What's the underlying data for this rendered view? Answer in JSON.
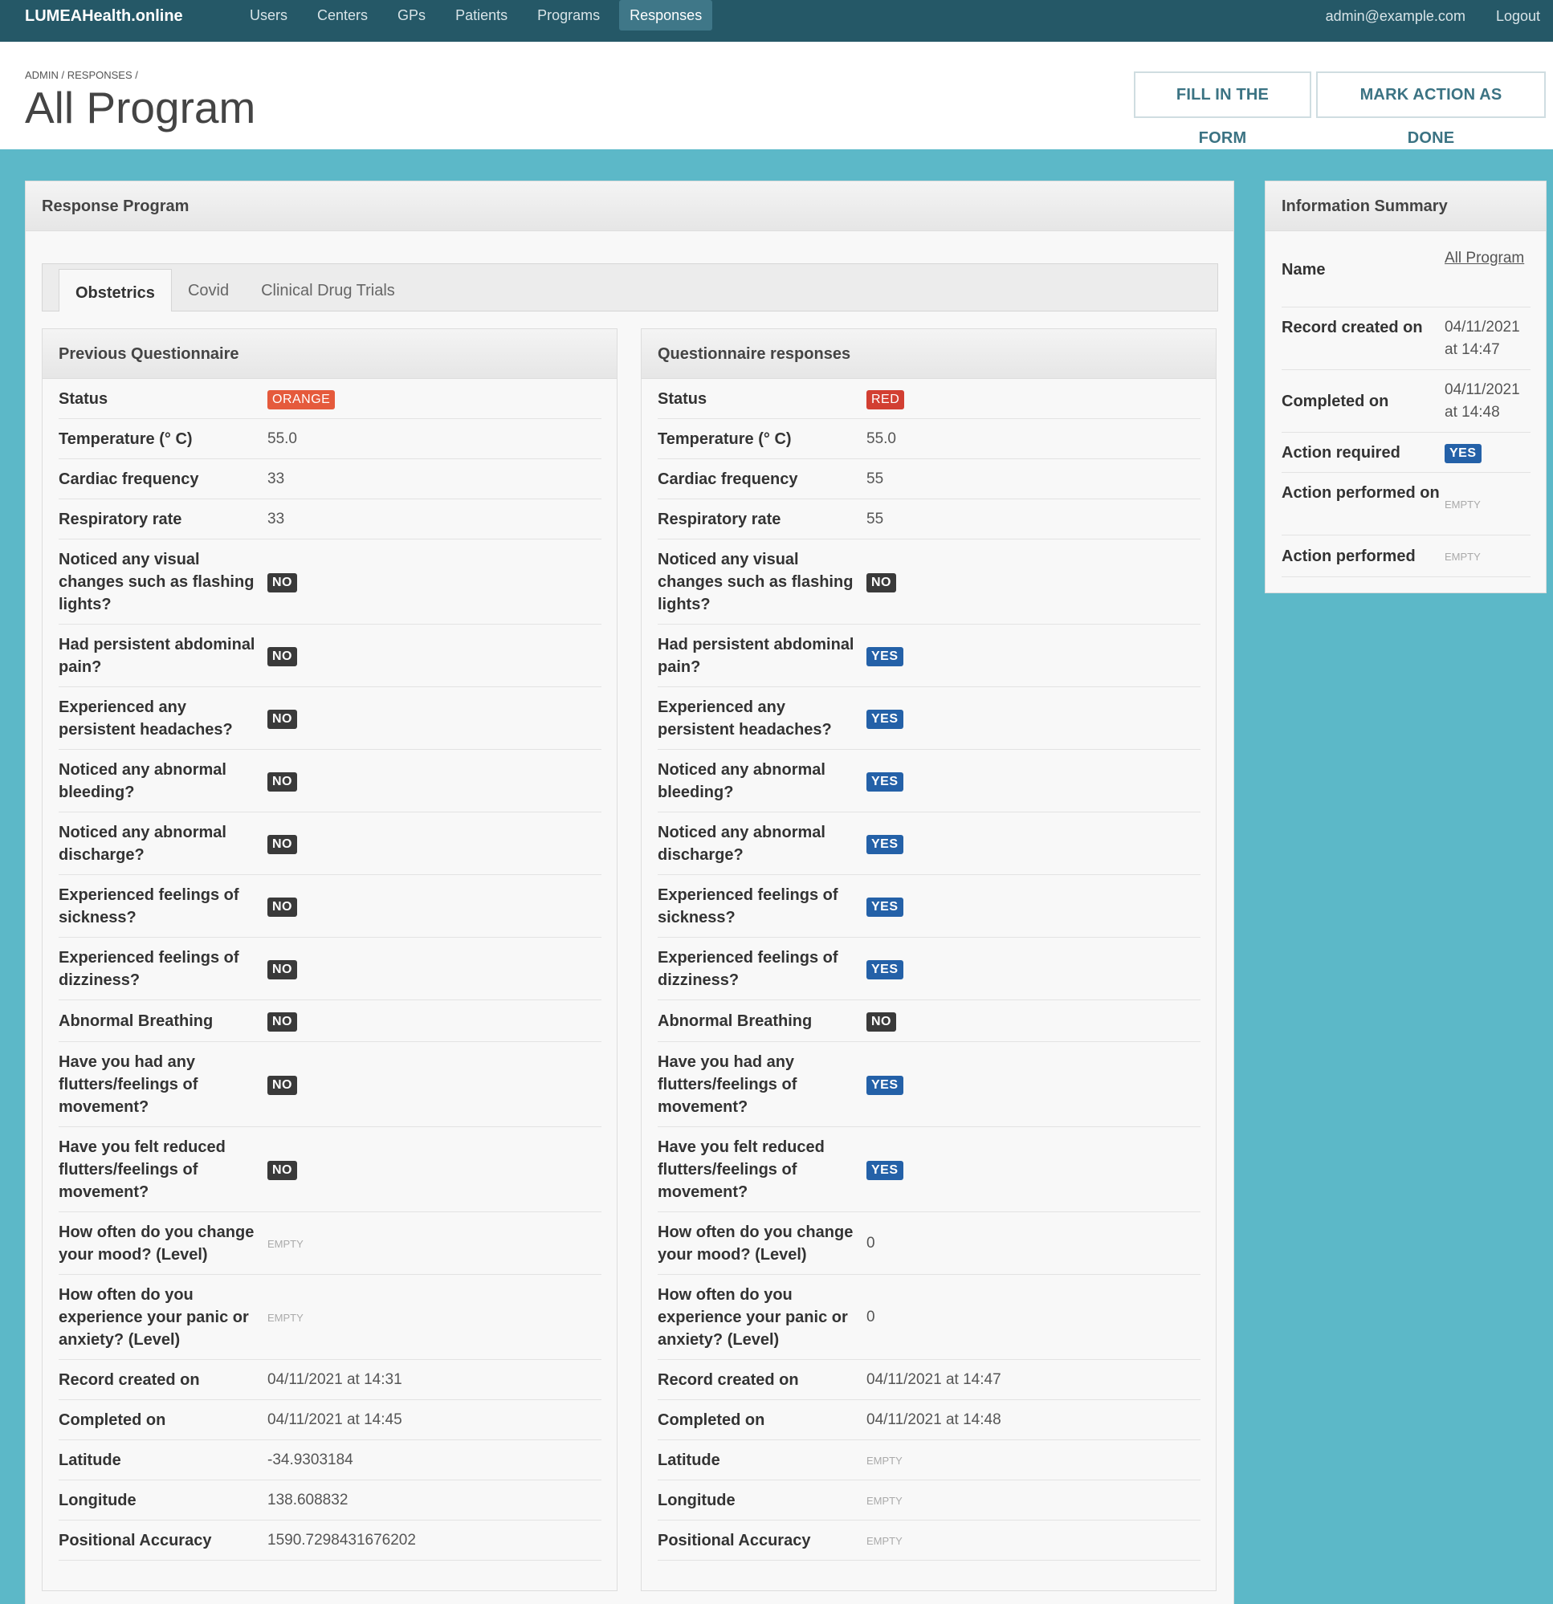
{
  "navbar": {
    "brand": "LUMEAHealth.online",
    "links": [
      "Users",
      "Centers",
      "GPs",
      "Patients",
      "Programs",
      "Responses"
    ],
    "active_index": 5,
    "user_email": "admin@example.com",
    "logout": "Logout"
  },
  "header": {
    "breadcrumb": "ADMIN / RESPONSES /",
    "title": "All Program",
    "fill_button": "FILL IN THE FORM",
    "mark_button": "MARK ACTION AS DONE"
  },
  "main": {
    "title": "Response Program",
    "tabs": [
      "Obstetrics",
      "Covid",
      "Clinical Drug Trials"
    ],
    "active_tab": 0,
    "previous": {
      "title": "Previous Questionnaire",
      "rows": [
        {
          "label": "Status",
          "value": "ORANGE",
          "type": "orange"
        },
        {
          "label": "Temperature (° C)",
          "value": "55.0",
          "type": "text"
        },
        {
          "label": "Cardiac frequency",
          "value": "33",
          "type": "text"
        },
        {
          "label": "Respiratory rate",
          "value": "33",
          "type": "text"
        },
        {
          "label": "Noticed any visual changes such as flashing lights?",
          "value": "NO",
          "type": "no"
        },
        {
          "label": "Had persistent abdominal pain?",
          "value": "NO",
          "type": "no"
        },
        {
          "label": "Experienced any persistent headaches?",
          "value": "NO",
          "type": "no"
        },
        {
          "label": "Noticed any abnormal bleeding?",
          "value": "NO",
          "type": "no"
        },
        {
          "label": "Noticed any abnormal discharge?",
          "value": "NO",
          "type": "no"
        },
        {
          "label": "Experienced feelings of sickness?",
          "value": "NO",
          "type": "no"
        },
        {
          "label": "Experienced feelings of dizziness?",
          "value": "NO",
          "type": "no"
        },
        {
          "label": "Abnormal Breathing",
          "value": "NO",
          "type": "no"
        },
        {
          "label": "Have you had any flutters/feelings of movement?",
          "value": "NO",
          "type": "no"
        },
        {
          "label": "Have you felt reduced flutters/feelings of movement?",
          "value": "NO",
          "type": "no"
        },
        {
          "label": "How often do you change your mood? (Level)",
          "value": "EMPTY",
          "type": "empty"
        },
        {
          "label": "How often do you experience your panic or anxiety? (Level)",
          "value": "EMPTY",
          "type": "empty"
        },
        {
          "label": "Record created on",
          "value": "04/11/2021 at 14:31",
          "type": "text"
        },
        {
          "label": "Completed on",
          "value": "04/11/2021 at 14:45",
          "type": "text"
        },
        {
          "label": "Latitude",
          "value": "-34.9303184",
          "type": "text"
        },
        {
          "label": "Longitude",
          "value": "138.608832",
          "type": "text"
        },
        {
          "label": "Positional Accuracy",
          "value": "1590.7298431676202",
          "type": "text"
        }
      ]
    },
    "current": {
      "title": "Questionnaire responses",
      "rows": [
        {
          "label": "Status",
          "value": "RED",
          "type": "red"
        },
        {
          "label": "Temperature (° C)",
          "value": "55.0",
          "type": "text"
        },
        {
          "label": "Cardiac frequency",
          "value": "55",
          "type": "text"
        },
        {
          "label": "Respiratory rate",
          "value": "55",
          "type": "text"
        },
        {
          "label": "Noticed any visual changes such as flashing lights?",
          "value": "NO",
          "type": "no"
        },
        {
          "label": "Had persistent abdominal pain?",
          "value": "YES",
          "type": "yes"
        },
        {
          "label": "Experienced any persistent headaches?",
          "value": "YES",
          "type": "yes"
        },
        {
          "label": "Noticed any abnormal bleeding?",
          "value": "YES",
          "type": "yes"
        },
        {
          "label": "Noticed any abnormal discharge?",
          "value": "YES",
          "type": "yes"
        },
        {
          "label": "Experienced feelings of sickness?",
          "value": "YES",
          "type": "yes"
        },
        {
          "label": "Experienced feelings of dizziness?",
          "value": "YES",
          "type": "yes"
        },
        {
          "label": "Abnormal Breathing",
          "value": "NO",
          "type": "no"
        },
        {
          "label": "Have you had any flutters/feelings of movement?",
          "value": "YES",
          "type": "yes"
        },
        {
          "label": "Have you felt reduced flutters/feelings of movement?",
          "value": "YES",
          "type": "yes"
        },
        {
          "label": "How often do you change your mood? (Level)",
          "value": "0",
          "type": "text"
        },
        {
          "label": "How often do you experience your panic or anxiety? (Level)",
          "value": "0",
          "type": "text"
        },
        {
          "label": "Record created on",
          "value": "04/11/2021 at 14:47",
          "type": "text"
        },
        {
          "label": "Completed on",
          "value": "04/11/2021 at 14:48",
          "type": "text"
        },
        {
          "label": "Latitude",
          "value": "EMPTY",
          "type": "empty"
        },
        {
          "label": "Longitude",
          "value": "EMPTY",
          "type": "empty"
        },
        {
          "label": "Positional Accuracy",
          "value": "EMPTY",
          "type": "empty"
        }
      ]
    }
  },
  "summary": {
    "title": "Information Summary",
    "rows": [
      {
        "label": "Name",
        "value": "All Program",
        "type": "link"
      },
      {
        "label": "Record created on",
        "value": "04/11/2021 at 14:47",
        "type": "text"
      },
      {
        "label": "Completed on",
        "value": "04/11/2021 at 14:48",
        "type": "text"
      },
      {
        "label": "Action required",
        "value": "YES",
        "type": "yes"
      },
      {
        "label": "Action performed on",
        "value": "EMPTY",
        "type": "empty"
      },
      {
        "label": "Action performed",
        "value": "EMPTY",
        "type": "empty"
      }
    ]
  },
  "colors": {
    "navbar": "#255867",
    "background": "#5cb8c8",
    "yes_badge": "#2461a8",
    "no_badge": "#3a3a3a",
    "orange_badge": "#e55a3c",
    "red_badge": "#d23f32"
  }
}
